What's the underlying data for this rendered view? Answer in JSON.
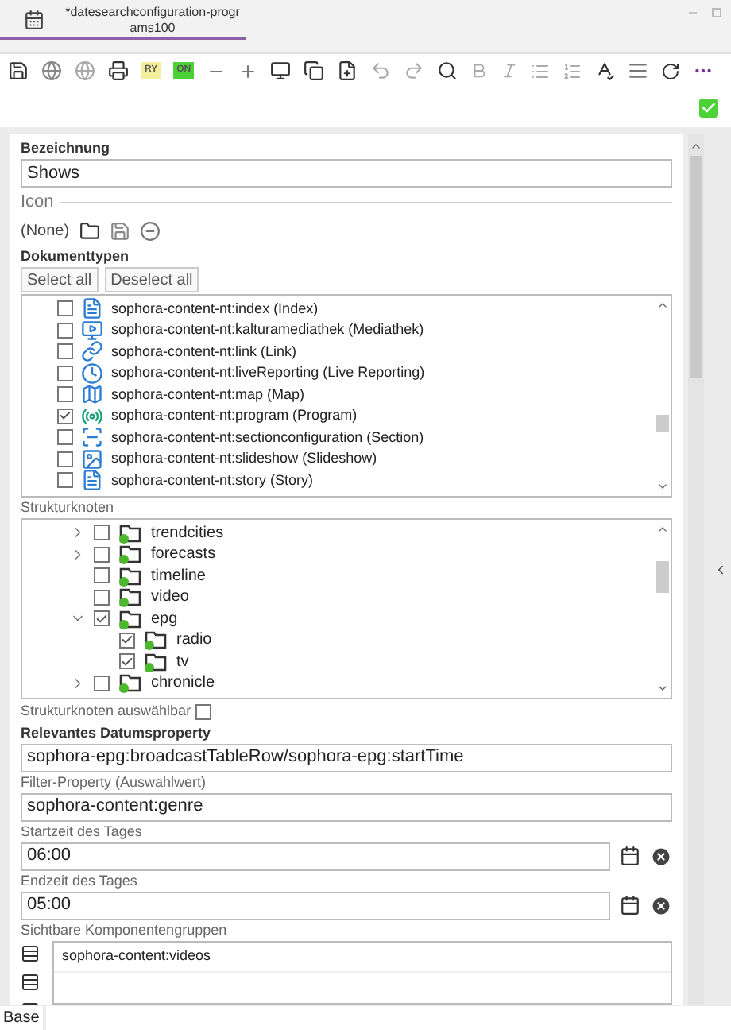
{
  "tab": {
    "title": "*datesearchconfiguration-programs100",
    "selected": true
  },
  "toolbar": {
    "badges": [
      {
        "text": "RY",
        "color": "#f3ef9c"
      },
      {
        "text": "ON",
        "color": "#4cd137"
      }
    ]
  },
  "form": {
    "name_label": "Bezeichnung",
    "name_value": "Shows",
    "icon_label": "Icon",
    "icon_value": "(None)",
    "doctypes_label": "Dokumenttypen",
    "select_all": "Select all",
    "deselect_all": "Deselect all",
    "doctypes": [
      {
        "kind": "page",
        "label": "sophora-content-nt:index (Index)",
        "checked": false
      },
      {
        "kind": "media",
        "label": "sophora-content-nt:kalturamediathek (Mediathek)",
        "checked": false
      },
      {
        "kind": "link",
        "label": "sophora-content-nt:link (Link)",
        "checked": false
      },
      {
        "kind": "live",
        "label": "sophora-content-nt:liveReporting (Live Reporting)",
        "checked": false
      },
      {
        "kind": "map",
        "label": "sophora-content-nt:map (Map)",
        "checked": false
      },
      {
        "kind": "program",
        "label": "sophora-content-nt:program (Program)",
        "checked": true
      },
      {
        "kind": "section",
        "label": "sophora-content-nt:sectionconfiguration (Section)",
        "checked": false
      },
      {
        "kind": "slideshow",
        "label": "sophora-content-nt:slideshow (Slideshow)",
        "checked": false
      },
      {
        "kind": "page",
        "label": "sophora-content-nt:story (Story)",
        "checked": false
      }
    ],
    "tree_label": "Strukturknoten",
    "tree": [
      {
        "label": "trendcities",
        "checked": false,
        "expanded": false
      },
      {
        "label": "forecasts",
        "checked": false,
        "expanded": false
      },
      {
        "label": "timeline",
        "checked": false
      },
      {
        "label": "video",
        "checked": false
      },
      {
        "label": "epg",
        "checked": true,
        "expanded": true,
        "children": [
          {
            "label": "radio",
            "checked": true
          },
          {
            "label": "tv",
            "checked": true
          }
        ]
      },
      {
        "label": "chronicle",
        "checked": false,
        "expanded": false
      }
    ],
    "tree_selectable_label": "Strukturknoten auswählbar",
    "tree_selectable": false,
    "date_prop_label": "Relevantes Datumsproperty",
    "date_prop_value": "sophora-epg:broadcastTableRow/sophora-epg:startTime",
    "filter_label": "Filter-Property (Auswahlwert)",
    "filter_value": "sophora-content:genre",
    "start_label": "Startzeit des Tages",
    "start_value": "06:00",
    "end_label": "Endzeit des Tages",
    "end_value": "05:00",
    "groups_label": "Sichtbare Komponentengruppen",
    "groups": [
      "sophora-content:videos"
    ]
  },
  "bottom_tab": "Base"
}
